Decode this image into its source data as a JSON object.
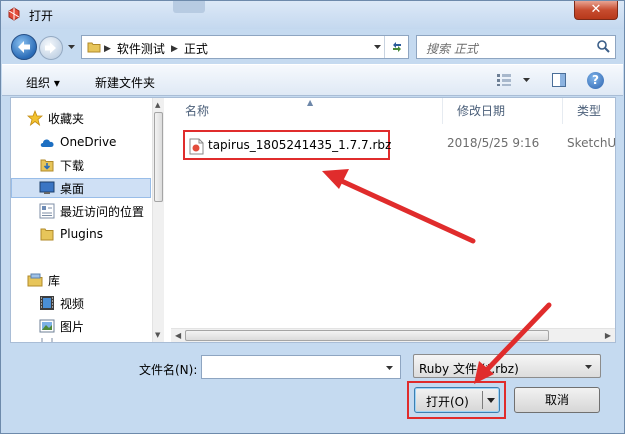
{
  "window": {
    "title": "打开",
    "close_label": "✕",
    "accent_color": "#2b6cb7",
    "highlight_color": "#e02c2c"
  },
  "address": {
    "crumbs": [
      "软件测试",
      "正式"
    ]
  },
  "search": {
    "placeholder": "搜索 正式"
  },
  "toolbar": {
    "organize_label": "组织 ▾",
    "new_folder_label": "新建文件夹",
    "help_label": "?"
  },
  "sidebar": {
    "items": [
      {
        "label": "收藏夹",
        "icon": "star-icon"
      },
      {
        "label": "OneDrive",
        "icon": "cloud-icon"
      },
      {
        "label": "下载",
        "icon": "folder-download-icon"
      },
      {
        "label": "桌面",
        "icon": "desktop-icon",
        "selected": true
      },
      {
        "label": "最近访问的位置",
        "icon": "recent-places-icon"
      },
      {
        "label": "Plugins",
        "icon": "folder-icon"
      },
      {
        "label": "库",
        "icon": "library-icon"
      },
      {
        "label": "视频",
        "icon": "video-icon"
      },
      {
        "label": "图片",
        "icon": "picture-icon"
      }
    ]
  },
  "columns": {
    "name": "名称",
    "date": "修改日期",
    "type": "类型"
  },
  "files": [
    {
      "name": "tapirus_1805241435_1.7.7.rbz",
      "date": "2018/5/25 9:16",
      "type": "SketchUp"
    }
  ],
  "footer": {
    "filename_label": "文件名(N):",
    "filename_value": "",
    "filetype_value": "Ruby 文件 (*.rbz)",
    "open_label": "打开(O)",
    "cancel_label": "取消"
  }
}
